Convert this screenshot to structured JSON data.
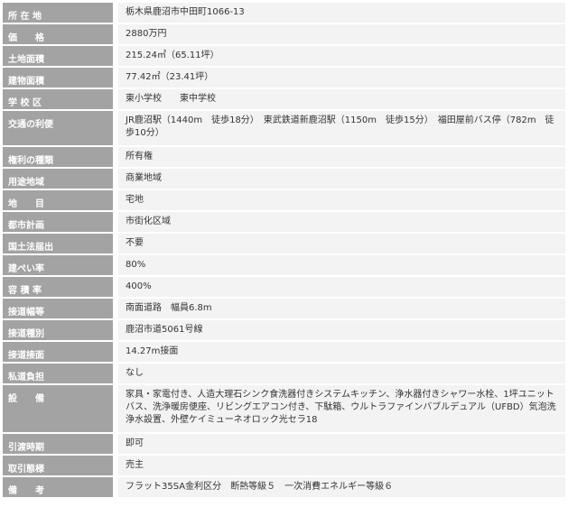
{
  "rows": [
    {
      "label": "所 在 地",
      "value": "栃木県鹿沼市中田町1066-13"
    },
    {
      "label": "価　　格",
      "value": "2880万円"
    },
    {
      "label": "土地面積",
      "value": "215.24㎡（65.11坪）"
    },
    {
      "label": "建物面積",
      "value": "77.42㎡（23.41坪）"
    },
    {
      "label": "学 校 区",
      "value": "東小学校　　東中学校"
    },
    {
      "label": "交通の利便",
      "value": "JR鹿沼駅（1440m　徒歩18分）　東武鉄道新鹿沼駅（1150m　徒歩15分）　福田屋前バス停（782m　徒歩10分）"
    },
    {
      "label": "権利の種類",
      "value": "所有権"
    },
    {
      "label": "用途地域",
      "value": "商業地域"
    },
    {
      "label": "地　　目",
      "value": "宅地"
    },
    {
      "label": "都市計画",
      "value": "市街化区域"
    },
    {
      "label": "国土法届出",
      "value": "不要"
    },
    {
      "label": "建ぺい率",
      "value": "80%"
    },
    {
      "label": "容 積 率",
      "value": "400%"
    },
    {
      "label": "接道幅等",
      "value": "南面道路　幅員6.8m"
    },
    {
      "label": "接道種別",
      "value": "鹿沼市道5061号線"
    },
    {
      "label": "接道接面",
      "value": "14.27m接面"
    },
    {
      "label": "私道負担",
      "value": "なし"
    },
    {
      "label": "設　　備",
      "value": "家具・家電付き、人造大理石シンク食洗器付きシステムキッチン、浄水器付きシャワー水栓、1坪ユニットバス、洗浄暖房便座、リビングエアコン付き、下駄箱、ウルトラファインバブルデュアル（UFBD）気泡洗浄水設置、外壁ケイミューネオロック光セラ18"
    },
    {
      "label": "引渡時期",
      "value": "即可"
    },
    {
      "label": "取引態様",
      "value": "売主"
    },
    {
      "label": "備　　考",
      "value": "フラット35SA金利区分　断熱等級５　一次消費エネルギー等級６"
    }
  ],
  "colors": {
    "label_bg": "#a3a3a3",
    "label_text": "#ffffff",
    "value_bg": "#f3f3f3",
    "value_text": "#333333"
  }
}
